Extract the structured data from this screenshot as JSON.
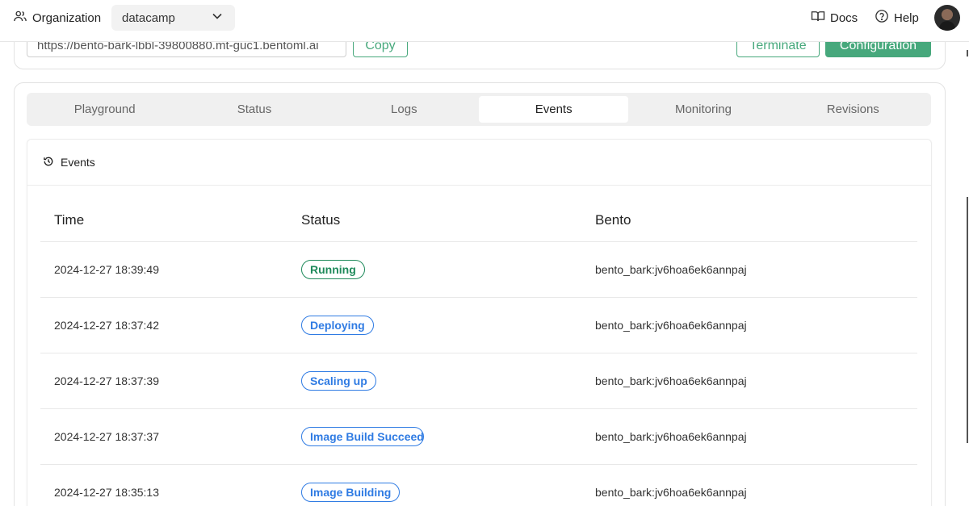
{
  "topbar": {
    "org_label": "Organization",
    "org_value": "datacamp",
    "docs_label": "Docs",
    "help_label": "Help"
  },
  "url_bar": {
    "url_value": "https://bento-bark-lbbl-39800880.mt-guc1.bentoml.ai",
    "copy_label": "Copy",
    "terminate_label": "Terminate",
    "configuration_label": "Configuration"
  },
  "tabs": [
    {
      "label": "Playground",
      "active": false
    },
    {
      "label": "Status",
      "active": false
    },
    {
      "label": "Logs",
      "active": false
    },
    {
      "label": "Events",
      "active": true
    },
    {
      "label": "Monitoring",
      "active": false
    },
    {
      "label": "Revisions",
      "active": false
    }
  ],
  "events": {
    "title": "Events",
    "columns": {
      "time": "Time",
      "status": "Status",
      "bento": "Bento"
    },
    "rows": [
      {
        "time": "2024-12-27 18:39:49",
        "status": "Running",
        "status_color": "green",
        "bento": "bento_bark:jv6hoa6ek6annpaj"
      },
      {
        "time": "2024-12-27 18:37:42",
        "status": "Deploying",
        "status_color": "blue",
        "bento": "bento_bark:jv6hoa6ek6annpaj"
      },
      {
        "time": "2024-12-27 18:37:39",
        "status": "Scaling up",
        "status_color": "blue",
        "bento": "bento_bark:jv6hoa6ek6annpaj"
      },
      {
        "time": "2024-12-27 18:37:37",
        "status": "Image Build Succeeded",
        "status_color": "blue",
        "bento": "bento_bark:jv6hoa6ek6annpaj"
      },
      {
        "time": "2024-12-27 18:35:13",
        "status": "Image Building",
        "status_color": "blue",
        "bento": "bento_bark:jv6hoa6ek6annpaj"
      }
    ]
  },
  "colors": {
    "accent_green": "#47a87c",
    "status_green": "#1f8a5b",
    "status_blue": "#2f7be3"
  }
}
